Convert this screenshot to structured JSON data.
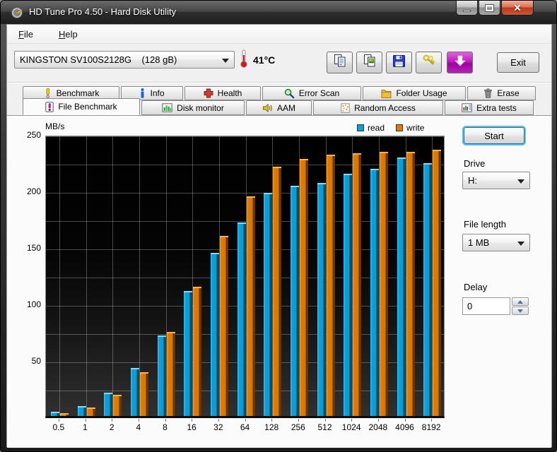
{
  "window": {
    "title": "HD Tune Pro 4.50 - Hard Disk Utility"
  },
  "menu": {
    "items": [
      {
        "label": "File"
      },
      {
        "label": "Help"
      }
    ]
  },
  "toolbar": {
    "drive_select_value": "KINGSTON SV100S2128G    (128 gB)",
    "temperature": "41°C",
    "buttons": [
      {
        "name": "copy-text-button",
        "icon": "copy-icon"
      },
      {
        "name": "copy-image-button",
        "icon": "copy-image-icon"
      },
      {
        "name": "save-button",
        "icon": "save-icon"
      },
      {
        "name": "options-button",
        "icon": "options-icon"
      },
      {
        "name": "capture-button",
        "icon": "arrow-down-icon"
      }
    ],
    "exit_label": "Exit"
  },
  "tabs": {
    "row1": [
      {
        "label": "Benchmark",
        "icon": "benchmark-icon",
        "active": false
      },
      {
        "label": "Info",
        "icon": "info-icon",
        "active": false
      },
      {
        "label": "Health",
        "icon": "health-icon",
        "active": false
      },
      {
        "label": "Error Scan",
        "icon": "error-scan-icon",
        "active": false
      },
      {
        "label": "Folder Usage",
        "icon": "folder-usage-icon",
        "active": false
      },
      {
        "label": "Erase",
        "icon": "erase-icon",
        "active": false
      }
    ],
    "row2": [
      {
        "label": "File Benchmark",
        "icon": "file-benchmark-icon",
        "active": true
      },
      {
        "label": "Disk monitor",
        "icon": "disk-monitor-icon",
        "active": false
      },
      {
        "label": "AAM",
        "icon": "aam-icon",
        "active": false
      },
      {
        "label": "Random Access",
        "icon": "random-access-icon",
        "active": false
      },
      {
        "label": "Extra tests",
        "icon": "extra-tests-icon",
        "active": false
      }
    ]
  },
  "controls": {
    "start_label": "Start",
    "drive_label": "Drive",
    "drive_value": "H:",
    "file_length_label": "File length",
    "file_length_value": "1 MB",
    "delay_label": "Delay",
    "delay_value": "0"
  },
  "chart_data": {
    "type": "bar",
    "title": "",
    "ylabel": "MB/s",
    "xlabel": "",
    "ylim": [
      0,
      250
    ],
    "y_ticks": [
      50,
      100,
      150,
      200,
      250
    ],
    "grid": true,
    "legend_position": "top-right",
    "categories": [
      "0.5",
      "1",
      "2",
      "4",
      "8",
      "16",
      "32",
      "64",
      "128",
      "256",
      "512",
      "1024",
      "2048",
      "4096",
      "8192"
    ],
    "series": [
      {
        "name": "read",
        "color": "#0aa0dc",
        "values": [
          6,
          11,
          23,
          45,
          74,
          113,
          147,
          174,
          200,
          206,
          209,
          217,
          221,
          231,
          226
        ]
      },
      {
        "name": "write",
        "color": "#e07b00",
        "values": [
          5,
          10,
          21,
          41,
          77,
          117,
          162,
          197,
          223,
          230,
          234,
          235,
          236,
          236,
          238
        ]
      }
    ]
  }
}
